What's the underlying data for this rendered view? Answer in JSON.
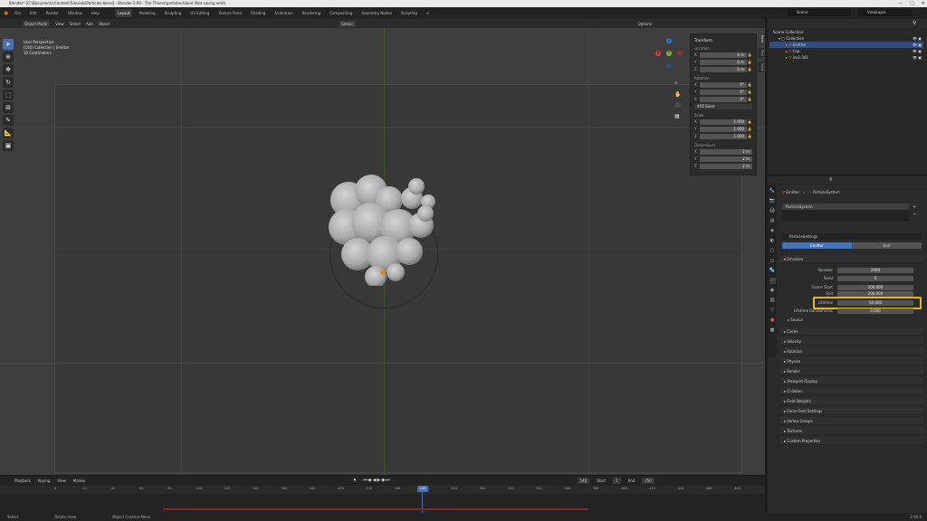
{
  "window": {
    "title": "Blender* [C:\\Documents\\Content\\Tutorials\\Particles.blend] - Blender 2.90 - The Theme\\particles.blend (Not saving emit)",
    "controls": [
      "—",
      "□",
      "✕"
    ]
  },
  "menu": {
    "items": [
      "File",
      "Edit",
      "Render",
      "Window",
      "Help"
    ],
    "workspaces": [
      "Layout",
      "Modeling",
      "Sculpting",
      "UV Editing",
      "Texture Paint",
      "Shading",
      "Animation",
      "Rendering",
      "Compositing",
      "Geometry Nodes",
      "Scripting"
    ],
    "active_workspace": "Layout",
    "scene": "Scene",
    "view_layer": "ViewLayer"
  },
  "viewport": {
    "header": {
      "mode": "Object Mode",
      "items": [
        "View",
        "Select",
        "Add",
        "Object"
      ],
      "transform": "Global",
      "options": "Options"
    },
    "info": [
      "User Perspective",
      "(140) Collection | Emitter",
      "10 Centimeters"
    ],
    "gizmo": {
      "x": "X",
      "y": "Y",
      "z": "Z"
    }
  },
  "npanel": {
    "title": "Transform",
    "location_label": "Location",
    "location": [
      {
        "axis": "X",
        "value": "0 m"
      },
      {
        "axis": "Y",
        "value": "0 m"
      },
      {
        "axis": "Z",
        "value": "0 m"
      }
    ],
    "rotation_label": "Rotation",
    "rotation": [
      {
        "axis": "X",
        "value": "0°"
      },
      {
        "axis": "Y",
        "value": "0°"
      },
      {
        "axis": "Z",
        "value": "0°"
      }
    ],
    "rotation_mode": "XYZ Euler",
    "scale_label": "Scale",
    "scale": [
      {
        "axis": "X",
        "value": "1.000"
      },
      {
        "axis": "Y",
        "value": "1.000"
      },
      {
        "axis": "Z",
        "value": "1.000"
      }
    ],
    "dimensions_label": "Dimensions",
    "dimensions": [
      {
        "axis": "X",
        "value": "2 m"
      },
      {
        "axis": "Y",
        "value": "2 m"
      },
      {
        "axis": "Z",
        "value": "2 m"
      }
    ],
    "tabs": [
      "Item",
      "Tool",
      "View"
    ]
  },
  "outliner": {
    "title": "Scene Collection",
    "rows": [
      {
        "label": "Scene Collection",
        "indent": 0,
        "selected": false
      },
      {
        "label": "Collection",
        "indent": 1,
        "selected": false
      },
      {
        "label": "Emitter",
        "indent": 2,
        "selected": true
      },
      {
        "label": "Cap",
        "indent": 2,
        "selected": false
      },
      {
        "label": "Ico1.001",
        "indent": 2,
        "selected": false
      }
    ]
  },
  "properties": {
    "breadcrumb_object": "Emitter",
    "breadcrumb_system": "ParticleSystem",
    "system_name": "ParticleSystem",
    "settings_name": "ParticleSettings",
    "type_options": [
      "Emitter",
      "Hair"
    ],
    "active_type": "Emitter",
    "emission_title": "Emission",
    "fields": [
      {
        "label": "Number",
        "value": "2000"
      },
      {
        "label": "Seed",
        "value": "0"
      },
      {
        "label": "Frame Start",
        "value": "100.000"
      },
      {
        "label": "End",
        "value": "200.000"
      },
      {
        "label": "Lifetime",
        "value": "50.000"
      }
    ],
    "lifetime_randomness_label": "Lifetime Randomness",
    "lifetime_randomness_value": "0.000",
    "source_label": "Source",
    "sections": [
      "Cache",
      "Velocity",
      "Rotation",
      "Physics",
      "Render",
      "Viewport Display",
      "Children",
      "Field Weights",
      "Force Field Settings",
      "Vertex Groups",
      "Textures",
      "Custom Properties"
    ]
  },
  "timeline": {
    "items": [
      "Playback",
      "Keying",
      "View",
      "Marker"
    ],
    "current_frame": "140",
    "start_label": "Start",
    "start": "1",
    "end_label": "End",
    "end": "250",
    "ticks": [
      "0",
      "20",
      "40",
      "60",
      "80",
      "100",
      "120",
      "140",
      "160",
      "180",
      "200",
      "220",
      "240",
      "260",
      "280",
      "300",
      "320",
      "340",
      "360",
      "380",
      "400",
      "420",
      "440",
      "460",
      "480",
      "500"
    ]
  },
  "status": {
    "items": [
      "Select",
      "Rotate View",
      "Object Context Menu"
    ],
    "version": "2.90.0"
  }
}
